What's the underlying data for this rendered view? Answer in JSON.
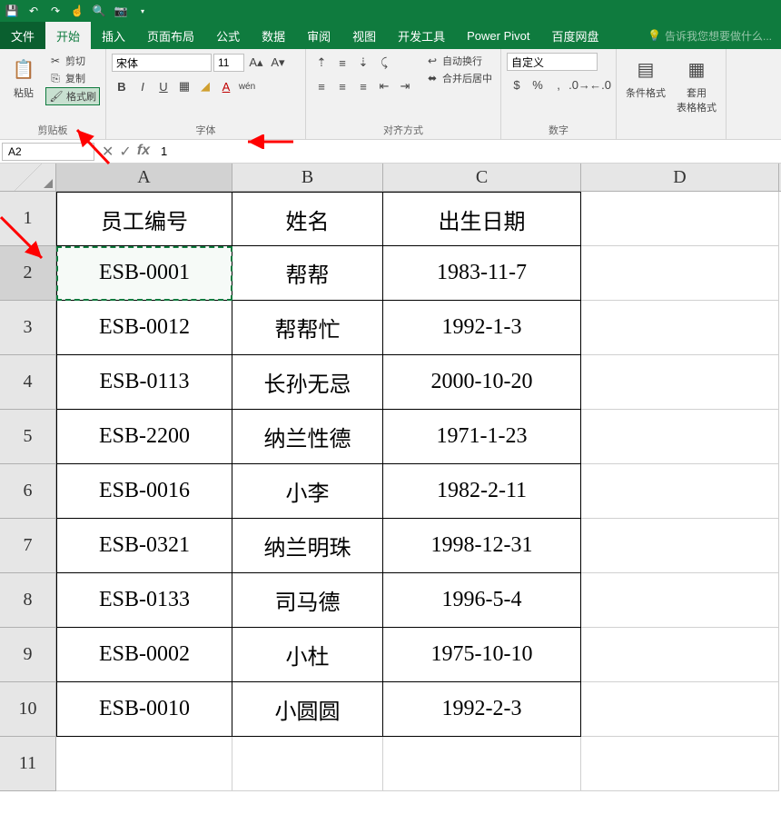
{
  "qat": {
    "save": "save-icon",
    "undo": "undo-icon",
    "redo": "redo-icon",
    "touch": "touch-icon",
    "preview": "preview-icon",
    "camera": "camera-icon"
  },
  "tabs": [
    "文件",
    "开始",
    "插入",
    "页面布局",
    "公式",
    "数据",
    "审阅",
    "视图",
    "开发工具",
    "Power Pivot",
    "百度网盘"
  ],
  "active_tab_index": 1,
  "tell_me": "告诉我您想要做什么...",
  "ribbon": {
    "clipboard": {
      "paste": "粘贴",
      "cut": "剪切",
      "copy": "复制",
      "format_painter": "格式刷",
      "label": "剪贴板"
    },
    "font": {
      "name": "宋体",
      "size": "11",
      "label": "字体"
    },
    "align": {
      "wrap": "自动换行",
      "merge": "合并后居中",
      "label": "对齐方式"
    },
    "number": {
      "format": "自定义",
      "label": "数字"
    },
    "styles": {
      "cond": "条件格式",
      "table": "套用\n表格格式"
    }
  },
  "namebox": "A2",
  "formula": "1",
  "columns": [
    "A",
    "B",
    "C",
    "D"
  ],
  "rows": [
    "1",
    "2",
    "3",
    "4",
    "5",
    "6",
    "7",
    "8",
    "9",
    "10",
    "11"
  ],
  "selected_cell": "A2",
  "chart_data": {
    "type": "table",
    "headers": [
      "员工编号",
      "姓名",
      "出生日期"
    ],
    "rows": [
      [
        "ESB-0001",
        "帮帮",
        "1983-11-7"
      ],
      [
        "ESB-0012",
        "帮帮忙",
        "1992-1-3"
      ],
      [
        "ESB-0113",
        "长孙无忌",
        "2000-10-20"
      ],
      [
        "ESB-2200",
        "纳兰性德",
        "1971-1-23"
      ],
      [
        "ESB-0016",
        "小李",
        "1982-2-11"
      ],
      [
        "ESB-0321",
        "纳兰明珠",
        "1998-12-31"
      ],
      [
        "ESB-0133",
        "司马德",
        "1996-5-4"
      ],
      [
        "ESB-0002",
        "小杜",
        "1975-10-10"
      ],
      [
        "ESB-0010",
        "小圆圆",
        "1992-2-3"
      ]
    ]
  }
}
